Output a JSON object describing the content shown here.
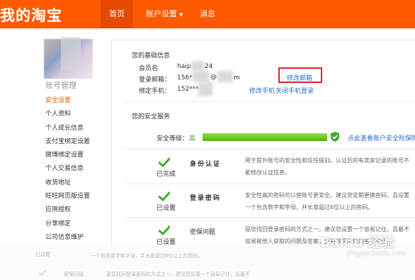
{
  "header": {
    "logo_text": "我的淘宝",
    "nav": {
      "home": "首页",
      "account_settings": "账户设置",
      "messages": "消息"
    },
    "brand_color": "#ff5a00"
  },
  "sidebar": {
    "title": "账号管理",
    "items": [
      {
        "label": "安全设置",
        "active": true
      },
      {
        "label": "个人资料"
      },
      {
        "label": "个人成长信息"
      },
      {
        "label": "支付宝绑定设置"
      },
      {
        "label": "微博绑定设置"
      },
      {
        "label": "个人交易信息"
      },
      {
        "label": "收货地址"
      },
      {
        "label": "旺旺网页版设置"
      },
      {
        "label": "应用授权"
      },
      {
        "label": "分享绑定"
      },
      {
        "label": "公司信息维护"
      }
    ]
  },
  "basic_info": {
    "title": "您的基础信息",
    "member_label": "会员名",
    "member_value": "haip",
    "member_value_tail": "24",
    "email_label": "登录邮箱：",
    "email_value": "156*",
    "email_value_tail": "@",
    "email_value_end": "m",
    "phone_label": "绑定手机：",
    "phone_value": "152***",
    "change_email_link": "修改邮箱",
    "change_phone_link": "修改手机",
    "close_phone_login_link": "关闭手机登录"
  },
  "security": {
    "title": "您的安全服务",
    "level_label": "安全等级：",
    "level_value": "高",
    "level_fraction": 1.0,
    "check_link": "点此查看账户安全险保障",
    "services": [
      {
        "icon": "check-icon",
        "status": "已完成",
        "name": "身份认证",
        "desc_lines": [
          "用于提升账号的安全性和信任级别。认证后的有卖家记录的账号不",
          "能修改认证信息。"
        ]
      },
      {
        "icon": "check-icon",
        "status": "已设置",
        "name": "登录密码",
        "desc_lines": [
          "安全性高的密码可以使账号更安全。建议您定期更换密码，且设置",
          "一个包含数字和字母，并长度超过6位以上的密码。"
        ]
      },
      {
        "icon": "check-icon",
        "status": "已设置",
        "name": "密保问题",
        "desc_lines": [
          "是您找回登录密码的方式之一。建议您设置一个容易记住，且最不",
          "容易被他人获取的问题及答案，更有效保障您的密码安全。"
        ]
      }
    ]
  },
  "faded_rows": {
    "status_1": "已设置",
    "desc_1": "一个包含数字和字母，并长度超过6位以上的密码。",
    "name_2": "密保问题",
    "desc_2": "是您找回登录密码的方式之一。建议您设置一个容易记住，且最不"
  },
  "watermark": {
    "logo": "Baidu 经验",
    "sub": "jingyan.baidu.com"
  }
}
